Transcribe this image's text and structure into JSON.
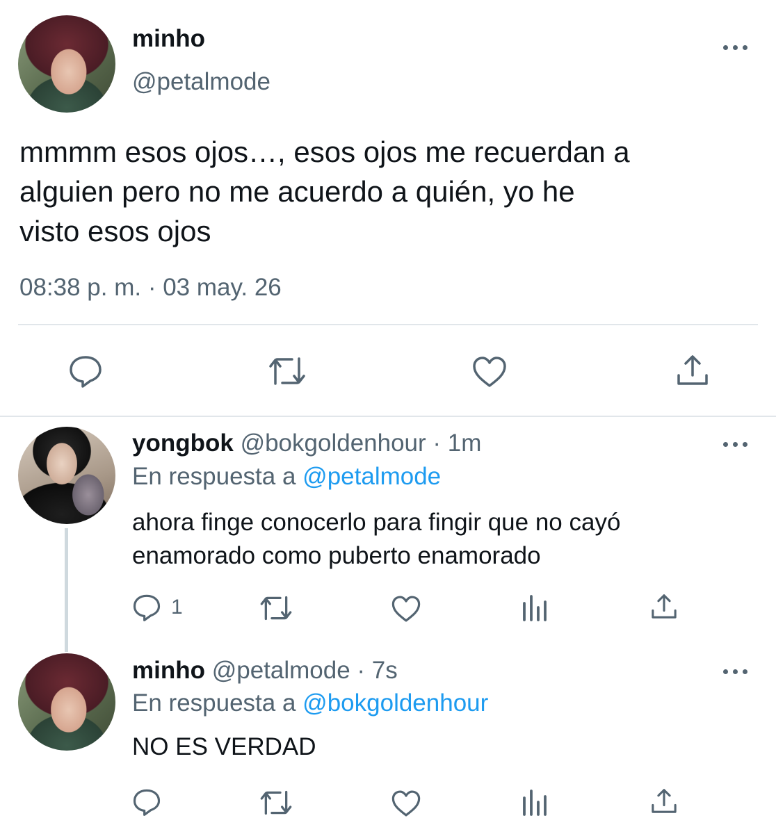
{
  "main_tweet": {
    "name": "minho",
    "handle": "@petalmode",
    "text_line1": "mmmm esos ojos…, esos ojos me recuerdan a",
    "text_line2": "alguien pero no me acuerdo a quién, yo he",
    "text_line3": "visto esos ojos",
    "timestamp": "08:38 p. m. · 03 may. 26"
  },
  "reply1": {
    "name": "yongbok",
    "handle_time": "@bokgoldenhour · 1m",
    "reply_prefix": "En respuesta a",
    "reply_to": "@petalmode",
    "text_line1": "ahora finge conocerlo para fingir que no cayó",
    "text_line2": "enamorado como puberto enamorado",
    "reply_count": "1"
  },
  "reply2": {
    "name": "minho",
    "handle_time": "@petalmode · 7s",
    "reply_prefix": "En respuesta a",
    "reply_to": "@bokgoldenhour",
    "text": "NO ES VERDAD"
  },
  "icons": [
    "reply-icon",
    "retweet-icon",
    "like-icon",
    "share-icon",
    "analytics-icon",
    "more-icon"
  ],
  "colors": {
    "text": "#0f1419",
    "secondary": "#536471",
    "link": "#1d9bf0",
    "divider": "#e1e6ea"
  }
}
